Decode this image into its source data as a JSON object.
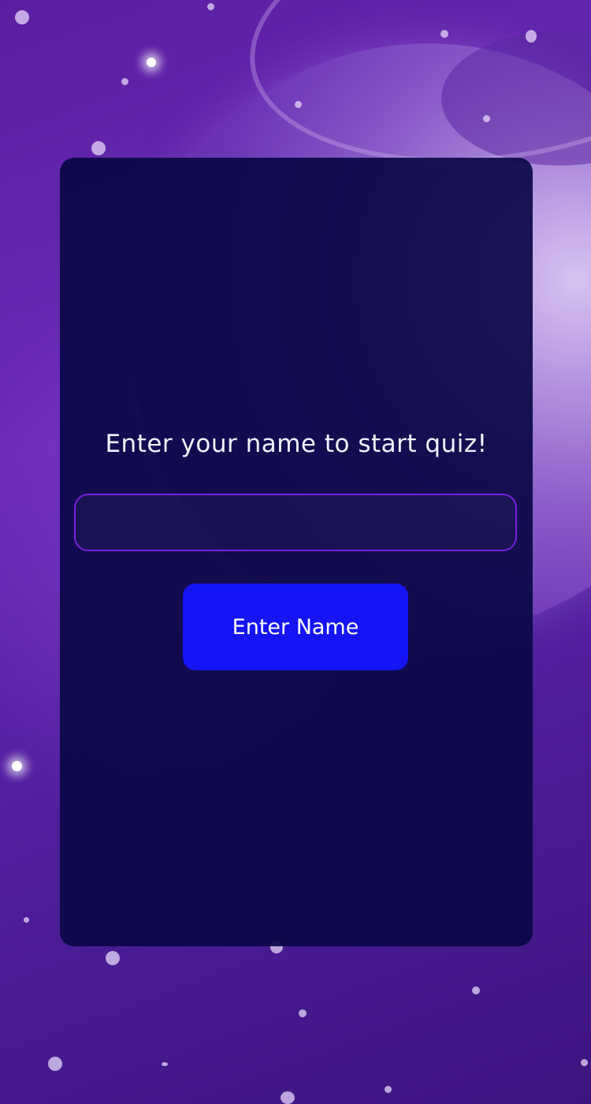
{
  "quiz": {
    "prompt": "Enter your name to start quiz!",
    "name_input_value": "",
    "name_input_placeholder": "",
    "submit_label": "Enter Name"
  },
  "theme": {
    "background": "#6a2ab8",
    "card": "#0a0846",
    "input_border": "#7a1fe0",
    "button": "#1414f5",
    "text": "#ffffff"
  }
}
